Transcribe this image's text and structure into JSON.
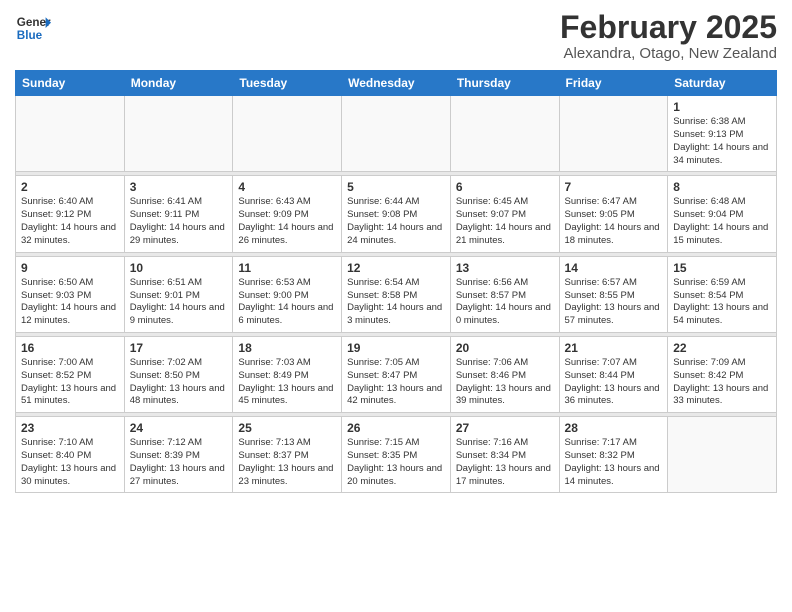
{
  "header": {
    "logo_general": "General",
    "logo_blue": "Blue",
    "calendar_title": "February 2025",
    "calendar_subtitle": "Alexandra, Otago, New Zealand"
  },
  "weekdays": [
    "Sunday",
    "Monday",
    "Tuesday",
    "Wednesday",
    "Thursday",
    "Friday",
    "Saturday"
  ],
  "weeks": [
    [
      {
        "day": "",
        "info": ""
      },
      {
        "day": "",
        "info": ""
      },
      {
        "day": "",
        "info": ""
      },
      {
        "day": "",
        "info": ""
      },
      {
        "day": "",
        "info": ""
      },
      {
        "day": "",
        "info": ""
      },
      {
        "day": "1",
        "info": "Sunrise: 6:38 AM\nSunset: 9:13 PM\nDaylight: 14 hours and 34 minutes."
      }
    ],
    [
      {
        "day": "2",
        "info": "Sunrise: 6:40 AM\nSunset: 9:12 PM\nDaylight: 14 hours and 32 minutes."
      },
      {
        "day": "3",
        "info": "Sunrise: 6:41 AM\nSunset: 9:11 PM\nDaylight: 14 hours and 29 minutes."
      },
      {
        "day": "4",
        "info": "Sunrise: 6:43 AM\nSunset: 9:09 PM\nDaylight: 14 hours and 26 minutes."
      },
      {
        "day": "5",
        "info": "Sunrise: 6:44 AM\nSunset: 9:08 PM\nDaylight: 14 hours and 24 minutes."
      },
      {
        "day": "6",
        "info": "Sunrise: 6:45 AM\nSunset: 9:07 PM\nDaylight: 14 hours and 21 minutes."
      },
      {
        "day": "7",
        "info": "Sunrise: 6:47 AM\nSunset: 9:05 PM\nDaylight: 14 hours and 18 minutes."
      },
      {
        "day": "8",
        "info": "Sunrise: 6:48 AM\nSunset: 9:04 PM\nDaylight: 14 hours and 15 minutes."
      }
    ],
    [
      {
        "day": "9",
        "info": "Sunrise: 6:50 AM\nSunset: 9:03 PM\nDaylight: 14 hours and 12 minutes."
      },
      {
        "day": "10",
        "info": "Sunrise: 6:51 AM\nSunset: 9:01 PM\nDaylight: 14 hours and 9 minutes."
      },
      {
        "day": "11",
        "info": "Sunrise: 6:53 AM\nSunset: 9:00 PM\nDaylight: 14 hours and 6 minutes."
      },
      {
        "day": "12",
        "info": "Sunrise: 6:54 AM\nSunset: 8:58 PM\nDaylight: 14 hours and 3 minutes."
      },
      {
        "day": "13",
        "info": "Sunrise: 6:56 AM\nSunset: 8:57 PM\nDaylight: 14 hours and 0 minutes."
      },
      {
        "day": "14",
        "info": "Sunrise: 6:57 AM\nSunset: 8:55 PM\nDaylight: 13 hours and 57 minutes."
      },
      {
        "day": "15",
        "info": "Sunrise: 6:59 AM\nSunset: 8:54 PM\nDaylight: 13 hours and 54 minutes."
      }
    ],
    [
      {
        "day": "16",
        "info": "Sunrise: 7:00 AM\nSunset: 8:52 PM\nDaylight: 13 hours and 51 minutes."
      },
      {
        "day": "17",
        "info": "Sunrise: 7:02 AM\nSunset: 8:50 PM\nDaylight: 13 hours and 48 minutes."
      },
      {
        "day": "18",
        "info": "Sunrise: 7:03 AM\nSunset: 8:49 PM\nDaylight: 13 hours and 45 minutes."
      },
      {
        "day": "19",
        "info": "Sunrise: 7:05 AM\nSunset: 8:47 PM\nDaylight: 13 hours and 42 minutes."
      },
      {
        "day": "20",
        "info": "Sunrise: 7:06 AM\nSunset: 8:46 PM\nDaylight: 13 hours and 39 minutes."
      },
      {
        "day": "21",
        "info": "Sunrise: 7:07 AM\nSunset: 8:44 PM\nDaylight: 13 hours and 36 minutes."
      },
      {
        "day": "22",
        "info": "Sunrise: 7:09 AM\nSunset: 8:42 PM\nDaylight: 13 hours and 33 minutes."
      }
    ],
    [
      {
        "day": "23",
        "info": "Sunrise: 7:10 AM\nSunset: 8:40 PM\nDaylight: 13 hours and 30 minutes."
      },
      {
        "day": "24",
        "info": "Sunrise: 7:12 AM\nSunset: 8:39 PM\nDaylight: 13 hours and 27 minutes."
      },
      {
        "day": "25",
        "info": "Sunrise: 7:13 AM\nSunset: 8:37 PM\nDaylight: 13 hours and 23 minutes."
      },
      {
        "day": "26",
        "info": "Sunrise: 7:15 AM\nSunset: 8:35 PM\nDaylight: 13 hours and 20 minutes."
      },
      {
        "day": "27",
        "info": "Sunrise: 7:16 AM\nSunset: 8:34 PM\nDaylight: 13 hours and 17 minutes."
      },
      {
        "day": "28",
        "info": "Sunrise: 7:17 AM\nSunset: 8:32 PM\nDaylight: 13 hours and 14 minutes."
      },
      {
        "day": "",
        "info": ""
      }
    ]
  ]
}
